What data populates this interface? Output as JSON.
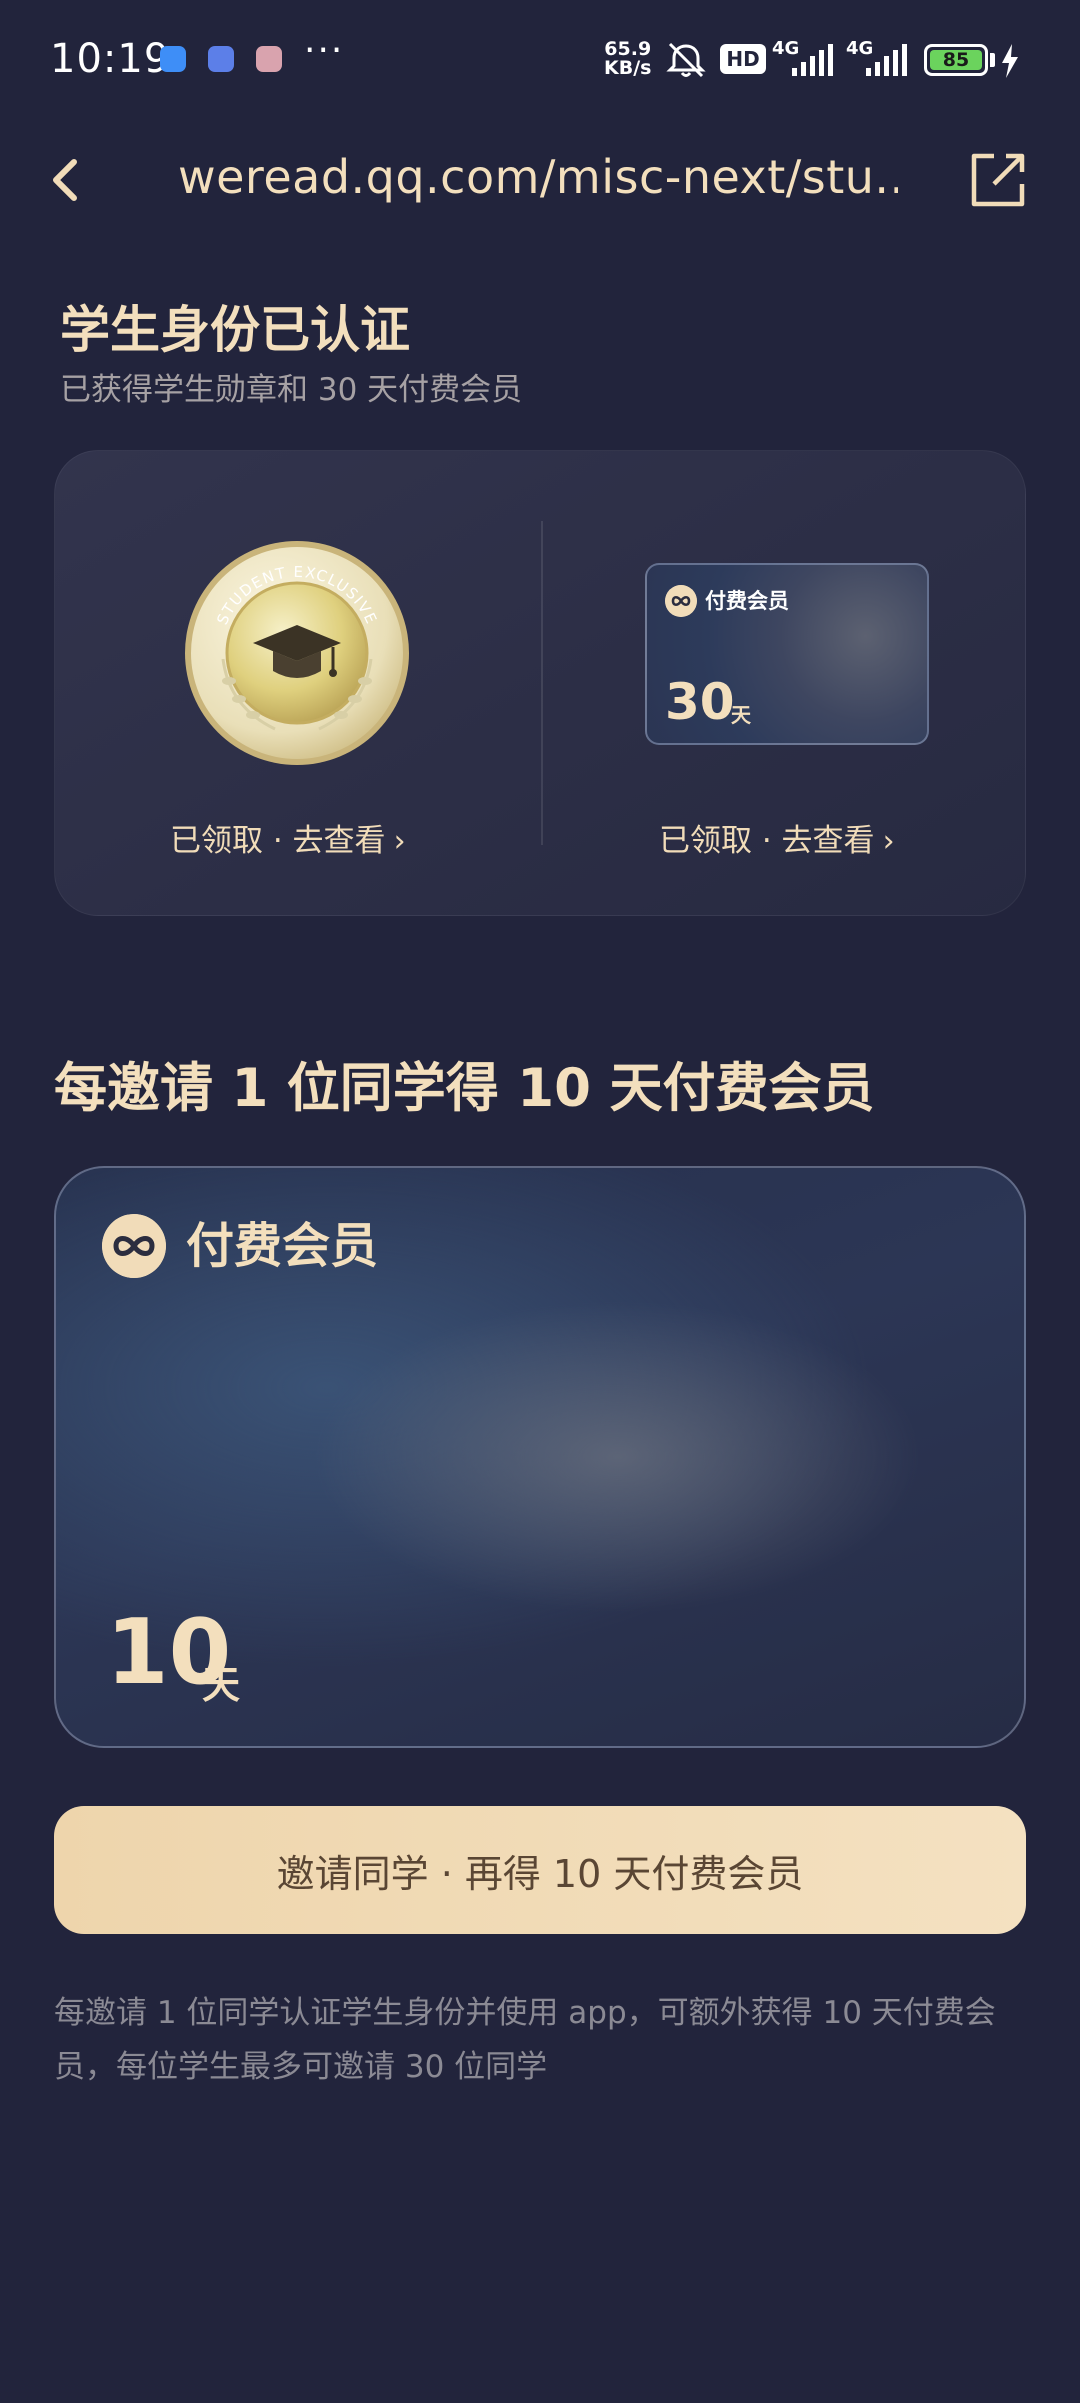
{
  "status_bar": {
    "time": "10:19",
    "net_speed_value": "65.9",
    "net_speed_unit": "KB/s",
    "hd_label": "HD",
    "network_1": "4G",
    "network_2": "4G",
    "battery": "85",
    "notification_icons": [
      "app-icon-blue",
      "app-icon-cloud",
      "app-icon-gallery"
    ],
    "overflow": "···"
  },
  "nav": {
    "url": "weread.qq.com/misc-next/stu...",
    "back_icon": "chevron-left-icon",
    "share_icon": "external-link-icon"
  },
  "verified": {
    "title": "学生身份已认证",
    "subtitle": "已获得学生勋章和 30 天付费会员",
    "medal_text": "STUDENT EXCLUSIVE",
    "badge_claim": "已领取 · 去查看",
    "membership_card": {
      "label": "付费会员",
      "days": "30",
      "unit": "天"
    },
    "membership_claim": "已领取 · 去查看"
  },
  "invite": {
    "title": "每邀请 1 位同学得 10 天付费会员",
    "card_label": "付费会员",
    "card_days": "10",
    "card_unit": "天",
    "button_label": "邀请同学 · 再得 10 天付费会员",
    "rules": "每邀请 1 位同学认证学生身份并使用 app，可额外获得 10 天付费会员，每位学生最多可邀请 30 位同学"
  },
  "colors": {
    "background": "#22243c",
    "gold_text": "#f3dfbd",
    "button_bg": "#f0d9b3",
    "button_text": "#5a4634",
    "muted_text": "#8b8a94"
  }
}
